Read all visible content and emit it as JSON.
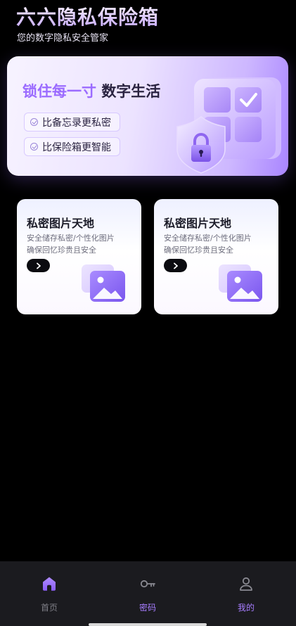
{
  "header": {
    "title": "六六隐私保险箱",
    "subtitle": "您的数字隐私安全管家"
  },
  "hero": {
    "headline_accent": "锁住每一寸",
    "headline_main": "数字生活",
    "features": [
      {
        "label": "比备忘录更私密",
        "icon": "check-circle-icon"
      },
      {
        "label": "比保险箱更智能",
        "icon": "check-circle-icon"
      }
    ],
    "art_icon": "shield-lock-vault-icon"
  },
  "cards": [
    {
      "title": "私密图片天地",
      "desc_line1": "安全储存私密/个性化图片",
      "desc_line2": "确保回忆珍贵且安全",
      "action_icon": "chevron-right-icon",
      "image_icon": "photo-gallery-icon"
    },
    {
      "title": "私密图片天地",
      "desc_line1": "安全储存私密/个性化图片",
      "desc_line2": "确保回忆珍贵且安全",
      "action_icon": "chevron-right-icon",
      "image_icon": "photo-gallery-icon"
    }
  ],
  "tabbar": {
    "tabs": [
      {
        "label": "首页",
        "icon": "home-icon"
      },
      {
        "label": "密码",
        "icon": "key-icon"
      },
      {
        "label": "我的",
        "icon": "user-icon"
      }
    ]
  },
  "colors": {
    "accent": "#9b6bff",
    "tab_active": "#a77dff",
    "tab_inactive": "#7f7f87",
    "background": "#000000",
    "tabbar_bg": "#1b1b1f"
  }
}
